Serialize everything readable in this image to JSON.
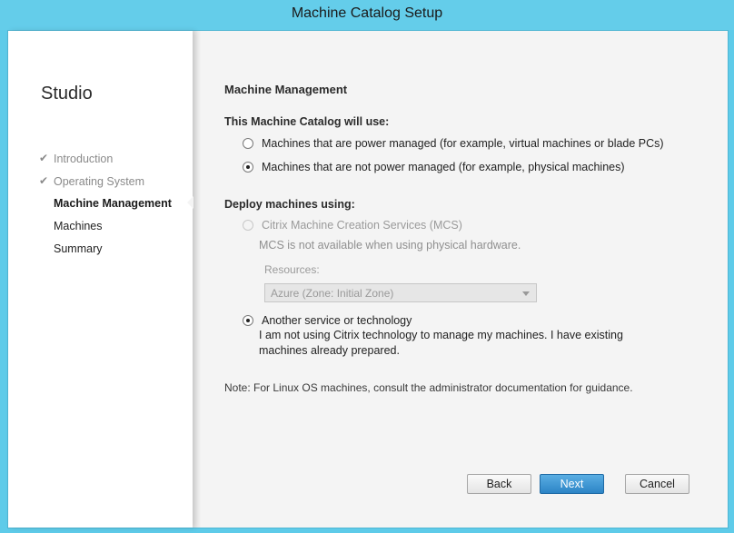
{
  "window": {
    "title": "Machine Catalog Setup"
  },
  "sidebar": {
    "brand": "Studio",
    "steps": [
      {
        "label": "Introduction",
        "state": "done"
      },
      {
        "label": "Operating System",
        "state": "done"
      },
      {
        "label": "Machine Management",
        "state": "active"
      },
      {
        "label": "Machines",
        "state": "pending"
      },
      {
        "label": "Summary",
        "state": "pending"
      }
    ]
  },
  "main": {
    "heading": "Machine Management",
    "catalog_section_label": "This Machine Catalog will use:",
    "catalog_options": [
      {
        "label": "Machines that are power managed (for example, virtual machines or blade PCs)",
        "selected": false
      },
      {
        "label": "Machines that are not power managed (for example, physical machines)",
        "selected": true
      }
    ],
    "deploy_section_label": "Deploy machines using:",
    "deploy_options": {
      "mcs": {
        "label": "Citrix Machine Creation Services (MCS)",
        "selected": false,
        "enabled": false,
        "description": "MCS is not available when using physical hardware.",
        "resources_label": "Resources:",
        "resources_value": "Azure (Zone: Initial Zone)"
      },
      "other": {
        "label": "Another service or technology",
        "selected": true,
        "description": "I am not using Citrix technology to manage my machines. I have existing machines already prepared."
      }
    },
    "note": "Note: For Linux OS machines, consult the administrator documentation for guidance."
  },
  "footer": {
    "back_label": "Back",
    "next_label": "Next",
    "cancel_label": "Cancel"
  },
  "colors": {
    "titlebar": "#64cdea",
    "primary_button": "#2c84c6"
  }
}
